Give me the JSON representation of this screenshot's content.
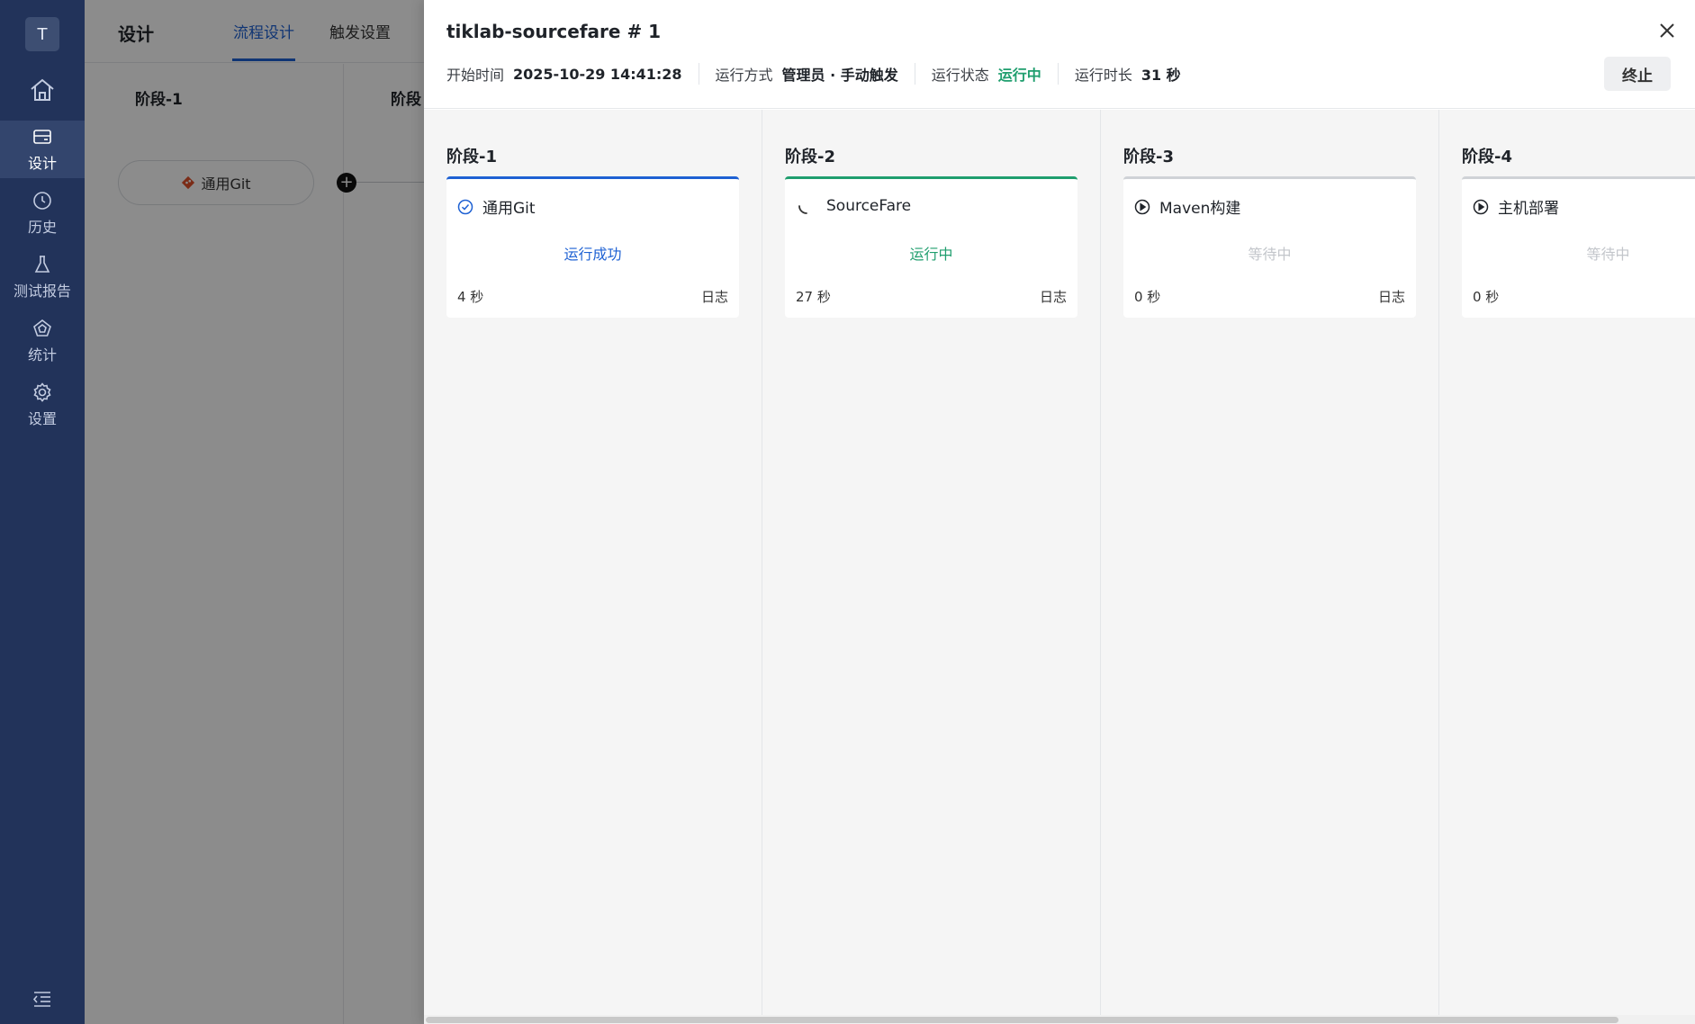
{
  "sidebar": {
    "avatar": "T",
    "items": [
      {
        "label": "设计",
        "icon": "design-icon"
      },
      {
        "label": "历史",
        "icon": "history-icon"
      },
      {
        "label": "测试报告",
        "icon": "test-report-icon"
      },
      {
        "label": "统计",
        "icon": "statistics-icon"
      },
      {
        "label": "设置",
        "icon": "settings-icon"
      }
    ]
  },
  "background": {
    "title": "设计",
    "tabs": [
      "流程设计",
      "触发设置"
    ],
    "stage1_title": "阶段-1",
    "stage2_title": "阶段",
    "task_label": "通用Git"
  },
  "drawer": {
    "title": "tiklab-sourcefare # 1",
    "meta": {
      "start_label": "开始时间",
      "start_value": "2025-10-29 14:41:28",
      "mode_label": "运行方式",
      "mode_value": "管理员 · 手动触发",
      "status_label": "运行状态",
      "status_value": "运行中",
      "duration_label": "运行时长",
      "duration_value": "31 秒"
    },
    "stop_label": "终止",
    "stages": [
      {
        "title": "阶段-1",
        "task": "通用Git",
        "status": "运行成功",
        "duration": "4 秒",
        "log": "日志"
      },
      {
        "title": "阶段-2",
        "task": "SourceFare",
        "status": "运行中",
        "duration": "27 秒",
        "log": "日志"
      },
      {
        "title": "阶段-3",
        "task": "Maven构建",
        "status": "等待中",
        "duration": "0 秒",
        "log": "日志"
      },
      {
        "title": "阶段-4",
        "task": "主机部署",
        "status": "等待中",
        "duration": "0 秒",
        "log": ""
      }
    ]
  },
  "colors": {
    "sidebar_bg": "#22335a",
    "accent_blue": "#1e61d3",
    "running_green": "#1f9e6e"
  }
}
